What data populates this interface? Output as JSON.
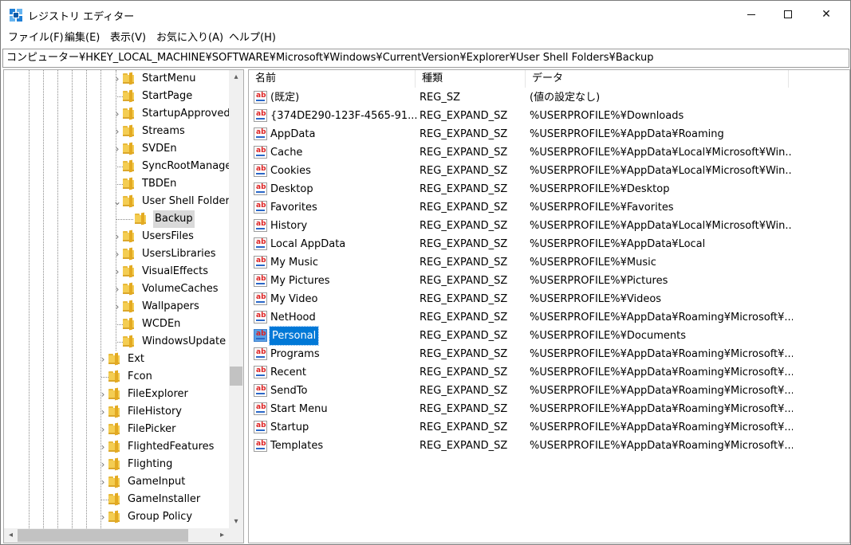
{
  "window": {
    "title": "レジストリ エディター",
    "min_glyph": "",
    "max_glyph": "",
    "close_glyph": "✕"
  },
  "menu": [
    "ファイル(F)",
    "編集(E)",
    "表示(V)",
    "お気に入り(A)",
    "ヘルプ(H)"
  ],
  "address": "コンピューター¥HKEY_LOCAL_MACHINE¥SOFTWARE¥Microsoft¥Windows¥CurrentVersion¥Explorer¥User Shell Folders¥Backup",
  "tree": {
    "items": [
      {
        "label": "StartMenu",
        "expander": "›",
        "level": 2
      },
      {
        "label": "StartPage",
        "expander": "",
        "level": 2
      },
      {
        "label": "StartupApproved",
        "expander": "›",
        "level": 2
      },
      {
        "label": "Streams",
        "expander": "›",
        "level": 2
      },
      {
        "label": "SVDEn",
        "expander": "›",
        "level": 2
      },
      {
        "label": "SyncRootManager",
        "expander": "",
        "level": 2
      },
      {
        "label": "TBDEn",
        "expander": "",
        "level": 2
      },
      {
        "label": "User Shell Folders",
        "expander": "⌄",
        "level": 2
      },
      {
        "label": "Backup",
        "expander": "",
        "level": 3,
        "selected": true
      },
      {
        "label": "UsersFiles",
        "expander": "›",
        "level": 2
      },
      {
        "label": "UsersLibraries",
        "expander": "›",
        "level": 2
      },
      {
        "label": "VisualEffects",
        "expander": "›",
        "level": 2
      },
      {
        "label": "VolumeCaches",
        "expander": "›",
        "level": 2
      },
      {
        "label": "Wallpapers",
        "expander": "›",
        "level": 2
      },
      {
        "label": "WCDEn",
        "expander": "",
        "level": 2
      },
      {
        "label": "WindowsUpdate",
        "expander": "",
        "level": 2
      },
      {
        "label": "Ext",
        "expander": "›",
        "level": 1
      },
      {
        "label": "Fcon",
        "expander": "",
        "level": 1
      },
      {
        "label": "FileExplorer",
        "expander": "›",
        "level": 1
      },
      {
        "label": "FileHistory",
        "expander": "›",
        "level": 1
      },
      {
        "label": "FilePicker",
        "expander": "›",
        "level": 1
      },
      {
        "label": "FlightedFeatures",
        "expander": "›",
        "level": 1
      },
      {
        "label": "Flighting",
        "expander": "›",
        "level": 1
      },
      {
        "label": "GameInput",
        "expander": "›",
        "level": 1
      },
      {
        "label": "GameInstaller",
        "expander": "",
        "level": 1
      },
      {
        "label": "Group Policy",
        "expander": "›",
        "level": 1
      }
    ],
    "scroll_up": "▴",
    "scroll_down": "▾",
    "scroll_left": "◂",
    "scroll_right": "▸"
  },
  "list": {
    "columns": [
      "名前",
      "種類",
      "データ"
    ],
    "rows": [
      {
        "name": "(既定)",
        "type": "REG_SZ",
        "data": "(値の設定なし)"
      },
      {
        "name": "{374DE290-123F-4565-91...",
        "type": "REG_EXPAND_SZ",
        "data": "%USERPROFILE%¥Downloads"
      },
      {
        "name": "AppData",
        "type": "REG_EXPAND_SZ",
        "data": "%USERPROFILE%¥AppData¥Roaming"
      },
      {
        "name": "Cache",
        "type": "REG_EXPAND_SZ",
        "data": "%USERPROFILE%¥AppData¥Local¥Microsoft¥Win..."
      },
      {
        "name": "Cookies",
        "type": "REG_EXPAND_SZ",
        "data": "%USERPROFILE%¥AppData¥Local¥Microsoft¥Win..."
      },
      {
        "name": "Desktop",
        "type": "REG_EXPAND_SZ",
        "data": "%USERPROFILE%¥Desktop"
      },
      {
        "name": "Favorites",
        "type": "REG_EXPAND_SZ",
        "data": "%USERPROFILE%¥Favorites"
      },
      {
        "name": "History",
        "type": "REG_EXPAND_SZ",
        "data": "%USERPROFILE%¥AppData¥Local¥Microsoft¥Win..."
      },
      {
        "name": "Local AppData",
        "type": "REG_EXPAND_SZ",
        "data": "%USERPROFILE%¥AppData¥Local"
      },
      {
        "name": "My Music",
        "type": "REG_EXPAND_SZ",
        "data": "%USERPROFILE%¥Music"
      },
      {
        "name": "My Pictures",
        "type": "REG_EXPAND_SZ",
        "data": "%USERPROFILE%¥Pictures"
      },
      {
        "name": "My Video",
        "type": "REG_EXPAND_SZ",
        "data": "%USERPROFILE%¥Videos"
      },
      {
        "name": "NetHood",
        "type": "REG_EXPAND_SZ",
        "data": "%USERPROFILE%¥AppData¥Roaming¥Microsoft¥..."
      },
      {
        "name": "Personal",
        "type": "REG_EXPAND_SZ",
        "data": "%USERPROFILE%¥Documents",
        "selected": true
      },
      {
        "name": "Programs",
        "type": "REG_EXPAND_SZ",
        "data": "%USERPROFILE%¥AppData¥Roaming¥Microsoft¥..."
      },
      {
        "name": "Recent",
        "type": "REG_EXPAND_SZ",
        "data": "%USERPROFILE%¥AppData¥Roaming¥Microsoft¥..."
      },
      {
        "name": "SendTo",
        "type": "REG_EXPAND_SZ",
        "data": "%USERPROFILE%¥AppData¥Roaming¥Microsoft¥..."
      },
      {
        "name": "Start Menu",
        "type": "REG_EXPAND_SZ",
        "data": "%USERPROFILE%¥AppData¥Roaming¥Microsoft¥..."
      },
      {
        "name": "Startup",
        "type": "REG_EXPAND_SZ",
        "data": "%USERPROFILE%¥AppData¥Roaming¥Microsoft¥..."
      },
      {
        "name": "Templates",
        "type": "REG_EXPAND_SZ",
        "data": "%USERPROFILE%¥AppData¥Roaming¥Microsoft¥..."
      }
    ],
    "value_icon": "ab"
  },
  "colors": {
    "selection": "#0078d7",
    "tree_selection": "#d9d9d9",
    "folder": "#f4cd52"
  }
}
